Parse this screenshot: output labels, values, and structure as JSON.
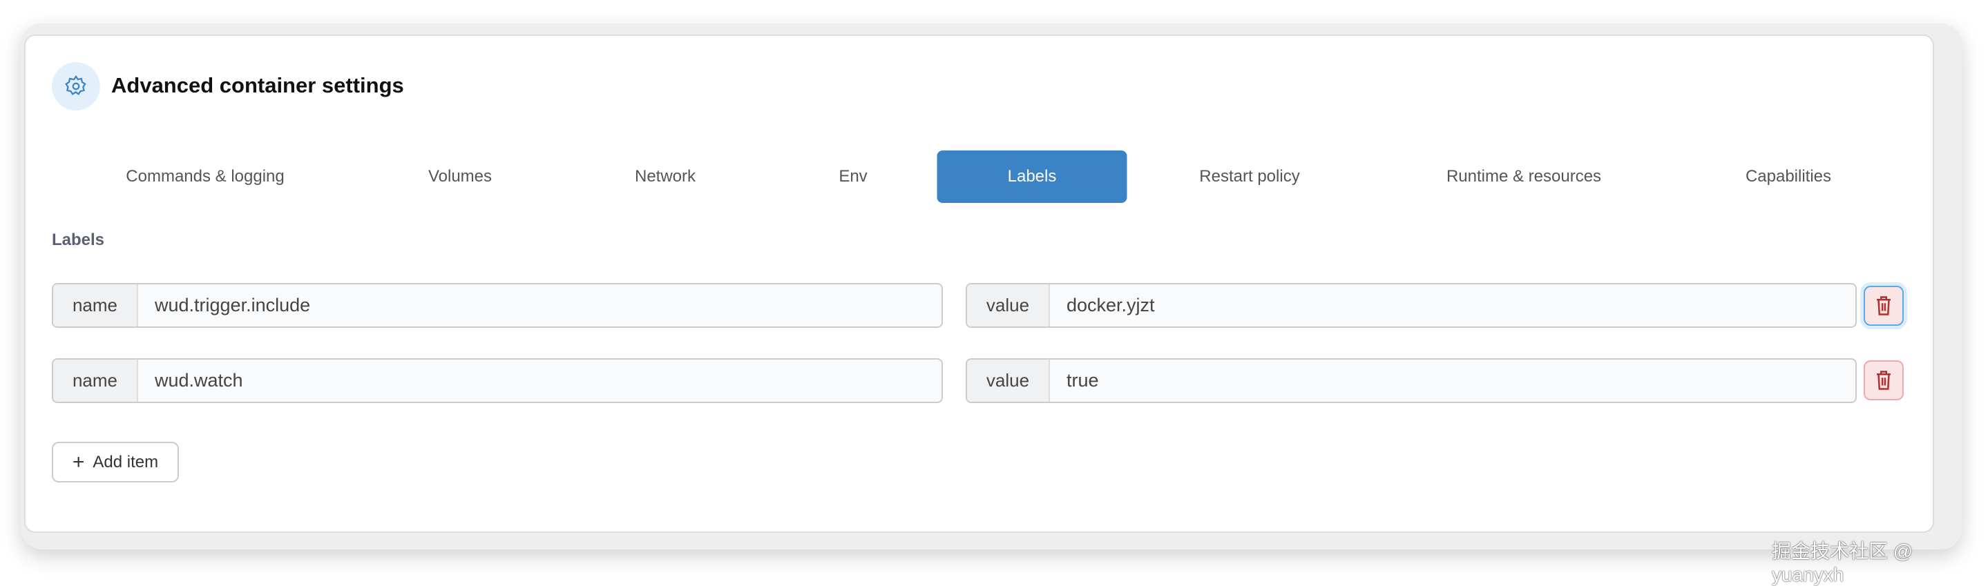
{
  "header": {
    "title": "Advanced container settings"
  },
  "tabs": [
    {
      "label": "Commands & logging"
    },
    {
      "label": "Volumes"
    },
    {
      "label": "Network"
    },
    {
      "label": "Env"
    },
    {
      "label": "Labels",
      "active": true
    },
    {
      "label": "Restart policy"
    },
    {
      "label": "Runtime & resources"
    },
    {
      "label": "Capabilities"
    }
  ],
  "section": {
    "heading": "Labels"
  },
  "rows": [
    {
      "name_label": "name",
      "name": "wud.trigger.include",
      "value_label": "value",
      "value": "docker.yjzt"
    },
    {
      "name_label": "name",
      "name": "wud.watch",
      "value_label": "value",
      "value": "true"
    }
  ],
  "add_label": "Add item",
  "watermark": "掘金技术社区 @ yuanyxh",
  "colors": {
    "accent": "#3a84c5",
    "danger_bg": "#fbe4e4",
    "danger": "#b03030"
  }
}
